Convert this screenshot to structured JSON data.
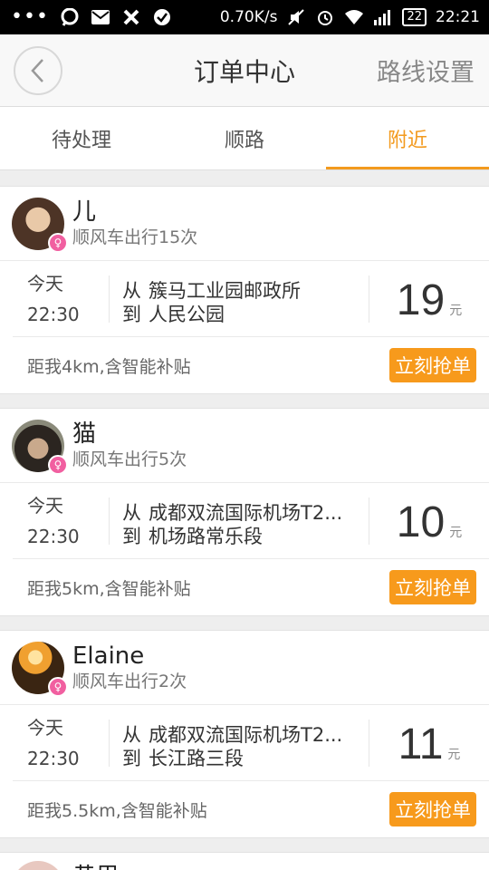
{
  "status_bar": {
    "speed": "0.70K/s",
    "battery": "22",
    "time": "22:21"
  },
  "nav": {
    "title": "订单中心",
    "right_action": "路线设置"
  },
  "tabs": [
    {
      "label": "待处理",
      "active": false
    },
    {
      "label": "顺路",
      "active": false
    },
    {
      "label": "附近",
      "active": true
    }
  ],
  "orders": [
    {
      "name": "儿",
      "trips": "顺风车出行15次",
      "day": "今天",
      "time": "22:30",
      "from_prefix": "从",
      "from": "簇马工业园邮政所",
      "to_prefix": "到",
      "to": "人民公园",
      "price": "19",
      "unit": "元",
      "distance": "距我4km,含智能补贴",
      "action": "立刻抢单"
    },
    {
      "name": "猫",
      "trips": "顺风车出行5次",
      "day": "今天",
      "time": "22:30",
      "from_prefix": "从",
      "from": "成都双流国际机场T2...",
      "to_prefix": "到",
      "to": "机场路常乐段",
      "price": "10",
      "unit": "元",
      "distance": "距我5km,含智能补贴",
      "action": "立刻抢单"
    },
    {
      "name": "Elaine",
      "trips": "顺风车出行2次",
      "day": "今天",
      "time": "22:30",
      "from_prefix": "从",
      "from": "成都双流国际机场T2...",
      "to_prefix": "到",
      "to": "长江路三段",
      "price": "11",
      "unit": "元",
      "distance": "距我5.5km,含智能补贴",
      "action": "立刻抢单"
    }
  ],
  "partial_order": {
    "name": "黄思"
  },
  "colors": {
    "accent": "#f39a1e",
    "button": "#f79a1c",
    "gender_badge": "#f15fa0"
  }
}
